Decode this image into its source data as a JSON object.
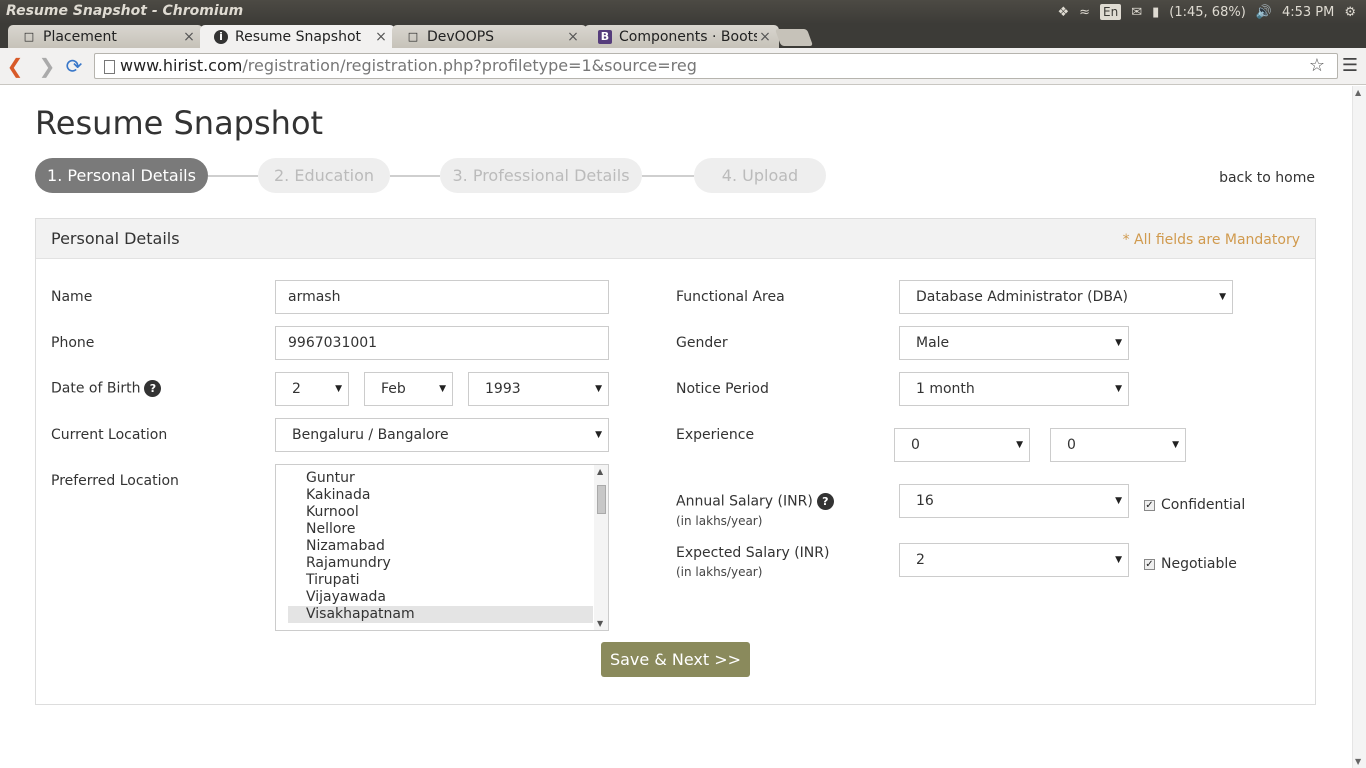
{
  "os": {
    "window_title": "Resume Snapshot - Chromium",
    "keyboard_lang": "En",
    "battery": "(1:45, 68%)",
    "clock": "4:53 PM"
  },
  "browser": {
    "tabs": [
      {
        "label": "Placement",
        "icon": "page-icon",
        "active": false
      },
      {
        "label": "Resume Snapshot",
        "icon": "info-icon",
        "active": true
      },
      {
        "label": "DevOOPS",
        "icon": "page-icon",
        "active": false
      },
      {
        "label": "Components · Bootstr",
        "icon": "bootstrap-icon",
        "active": false
      }
    ],
    "url_host": "www.hirist.com",
    "url_path": "/registration/registration.php?profiletype=1&source=reg"
  },
  "page": {
    "title": "Resume Snapshot",
    "steps": [
      "1. Personal Details",
      "2. Education",
      "3. Professional Details",
      "4. Upload"
    ],
    "back_link": "back to home",
    "panel_title": "Personal Details",
    "mandatory_note": "* All fields are Mandatory"
  },
  "form": {
    "name_label": "Name",
    "name_value": "armash",
    "phone_label": "Phone",
    "phone_value": "9967031001",
    "dob_label": "Date of Birth",
    "dob_day": "2",
    "dob_month": "Feb",
    "dob_year": "1993",
    "current_location_label": "Current Location",
    "current_location_value": "Bengaluru / Bangalore",
    "preferred_location_label": "Preferred Location",
    "preferred_locations": [
      "Guntur",
      "Kakinada",
      "Kurnool",
      "Nellore",
      "Nizamabad",
      "Rajamundry",
      "Tirupati",
      "Vijayawada",
      "Visakhapatnam"
    ],
    "preferred_selected": "Visakhapatnam",
    "functional_area_label": "Functional Area",
    "functional_area_value": "Database Administrator (DBA)",
    "gender_label": "Gender",
    "gender_value": "Male",
    "notice_label": "Notice Period",
    "notice_value": "1 month",
    "experience_label": "Experience",
    "experience_years": "0",
    "experience_months": "0",
    "annual_salary_label": "Annual Salary (INR)",
    "annual_salary_sub": "(in lakhs/year)",
    "annual_salary_value": "16",
    "confidential_label": "Confidential",
    "expected_salary_label": "Expected Salary (INR)",
    "expected_salary_sub": "(in lakhs/year)",
    "expected_salary_value": "2",
    "negotiable_label": "Negotiable",
    "save_label": "Save & Next >>"
  },
  "colors": {
    "active_step": "#7a7a7a",
    "mandatory_note": "#d09a4e",
    "save_button": "#8a8a5c"
  }
}
